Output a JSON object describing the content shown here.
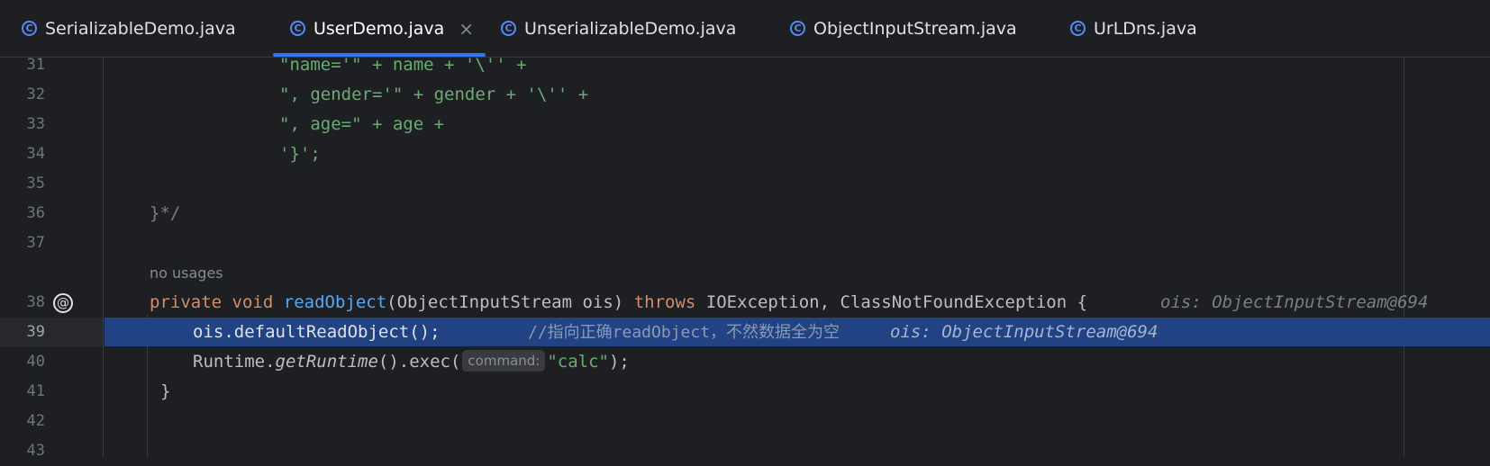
{
  "tabs": [
    {
      "label": "SerializableDemo.java",
      "icon": "class-icon"
    },
    {
      "label": "UserDemo.java",
      "icon": "class-icon",
      "active": true,
      "close": "×"
    },
    {
      "label": "UnserializableDemo.java",
      "icon": "class-icon"
    },
    {
      "label": "ObjectInputStream.java",
      "icon": "class-icon"
    },
    {
      "label": "UrLDns.java",
      "icon": "class-icon"
    }
  ],
  "class_icon_letter": "C",
  "lines": {
    "l31": {
      "num": "31",
      "code": "\"name='\" + name + '\\'' +"
    },
    "l32": {
      "num": "32",
      "code": "\", gender='\" + gender + '\\'' +"
    },
    "l33": {
      "num": "33",
      "code": "\", age=\" + age +"
    },
    "l34": {
      "num": "34",
      "code": "'}';"
    },
    "l35": {
      "num": "35"
    },
    "l36": {
      "num": "36",
      "code": "}*/"
    },
    "l37": {
      "num": "37"
    },
    "usage": "no usages",
    "l38": {
      "num": "38",
      "gutter_icon": "@",
      "kw1": "private",
      "kw2": "void",
      "method": "readObject",
      "params": "(ObjectInputStream ois)",
      "kw3": "throws",
      "exceptions": "IOException, ClassNotFoundException {",
      "hint": "ois: ObjectInputStream@694"
    },
    "l39": {
      "num": "39",
      "code": "ois.defaultReadObject();",
      "comment": "//指向正确readObject，不然数据全为空",
      "hint": "ois: ObjectInputStream@694"
    },
    "l40": {
      "num": "40",
      "class": "Runtime.",
      "method": "getRuntime",
      "rest": "().exec(",
      "param_hint": "command:",
      "string": "\"calc\"",
      "end": ");"
    },
    "l41": {
      "num": "41",
      "code": "}"
    },
    "l42": {
      "num": "42"
    },
    "l43": {
      "num": "43"
    }
  },
  "colors": {
    "background": "#1e1f22",
    "selection": "#214283",
    "keyword": "#cf8e6d",
    "string": "#6aab73",
    "method": "#56a8f5",
    "accent": "#3574f0"
  }
}
